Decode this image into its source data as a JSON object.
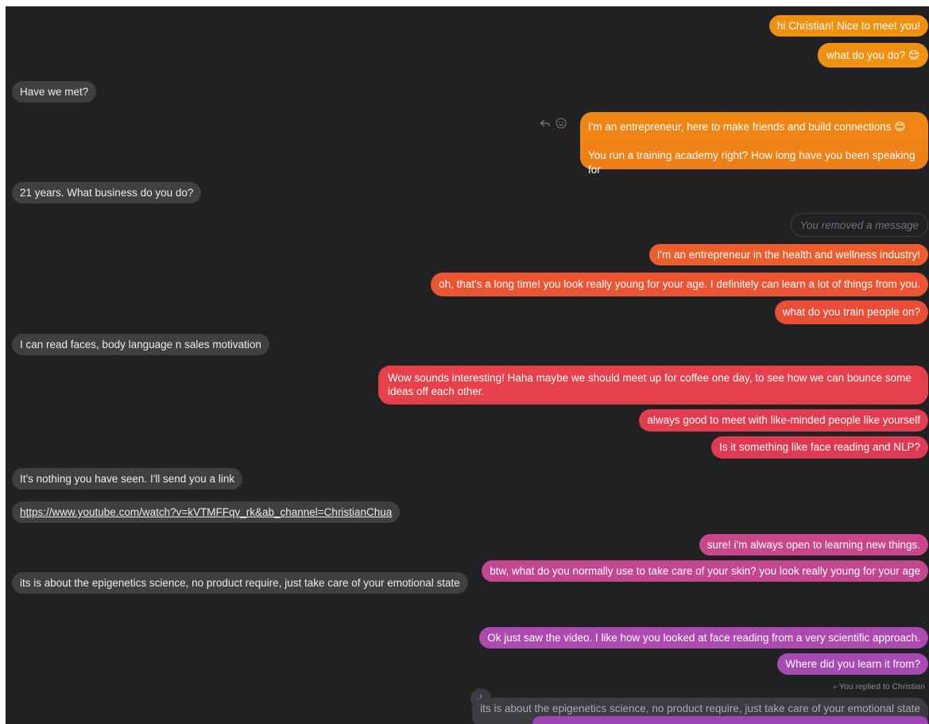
{
  "colors": {
    "background": "#1f2123",
    "incoming_bubble": "#3e4042",
    "outgoing_gradient": [
      "#f18c0e",
      "#ef5b34",
      "#e23c52",
      "#c8488c",
      "#a74bb4"
    ]
  },
  "messages": [
    {
      "side": "out",
      "text": "hi Christian! Nice to meet you!",
      "color": "#f0900f"
    },
    {
      "side": "out",
      "text": "what do you do? 😌",
      "color": "#f0920f"
    },
    {
      "side": "in",
      "text": "Have we met?"
    },
    {
      "side": "out",
      "text": "I'm an entrepreneur, here to make friends and build connections 😊\n\nYou run a training academy right? How long have you been speaking for",
      "color": "#ef8214"
    },
    {
      "side": "in",
      "text": "21 years. What business do you do?"
    },
    {
      "side": "removed",
      "text": "You removed a message"
    },
    {
      "side": "out",
      "text": "I'm an entrepreneur in the health and wellness industry!",
      "color": "#ee5d2e"
    },
    {
      "side": "out",
      "text": "oh, that's a long time! you look really young for your age. I definitely can learn a lot of things from you.",
      "color": "#ed5434"
    },
    {
      "side": "out",
      "text": "what do you train people on?",
      "color": "#eb4d37"
    },
    {
      "side": "in",
      "text": "I can read faces, body language n sales motivation"
    },
    {
      "side": "out",
      "text": "Wow sounds interesting! Haha maybe we should meet up for coffee one day, to see how we can bounce some ideas off each other.",
      "color": "#e6414a"
    },
    {
      "side": "out",
      "text": "always good to meet with like-minded people like yourself",
      "color": "#e23c4e"
    },
    {
      "side": "out",
      "text": "Is it something like face reading and NLP?",
      "color": "#df3a53"
    },
    {
      "side": "in",
      "text": "It's nothing you have seen. I'll send you a link"
    },
    {
      "side": "in",
      "text": "https://www.youtube.com/watch?v=kVTMFFqv_rk&ab_channel=ChristianChua",
      "link": true
    },
    {
      "side": "out",
      "text": "sure! i'm always open to learning new things.",
      "color": "#c9468a"
    },
    {
      "side": "out",
      "text": "btw, what do you normally use to take care of your skin? you look really young for your age",
      "color": "#c3478f"
    },
    {
      "side": "in",
      "text": "its is about the epigenetics science, no product require, just take care of your emotional state"
    },
    {
      "side": "out",
      "text": "Ok just saw the video. I like how you looked at face reading from a very scientific approach.",
      "color": "#ad49b1"
    },
    {
      "side": "out",
      "text": "Where did you learn it from?",
      "color": "#a84ab4"
    }
  ],
  "reply_indicator": {
    "label": "You replied to Christian",
    "quoted_text": "its is about the epigenetics science, no product require, just take care of your emotional state"
  },
  "hover_actions": [
    "reply-icon",
    "emoji-reaction-icon"
  ],
  "scroll_down_icon": "arrow-down-icon"
}
